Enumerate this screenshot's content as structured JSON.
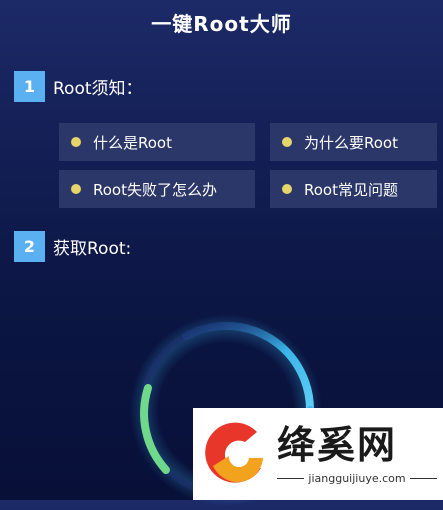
{
  "header": {
    "title": "一键Root大师"
  },
  "section1": {
    "number": "1",
    "title": "Root须知："
  },
  "faq": {
    "items": [
      {
        "label": "什么是Root"
      },
      {
        "label": "为什么要Root"
      },
      {
        "label": "Root失败了怎么办"
      },
      {
        "label": "Root常见问题"
      }
    ]
  },
  "section2": {
    "number": "2",
    "title": "获取Root:"
  },
  "watermark": {
    "name": "绛奚网",
    "url": "jiangguijiuye.com"
  },
  "colors": {
    "accent": "#5ab0f0",
    "bullet": "#e5d56a",
    "button_bg": "#2a3768",
    "ring_blue": "#3ab4e8",
    "ring_green": "#6fd88a"
  }
}
